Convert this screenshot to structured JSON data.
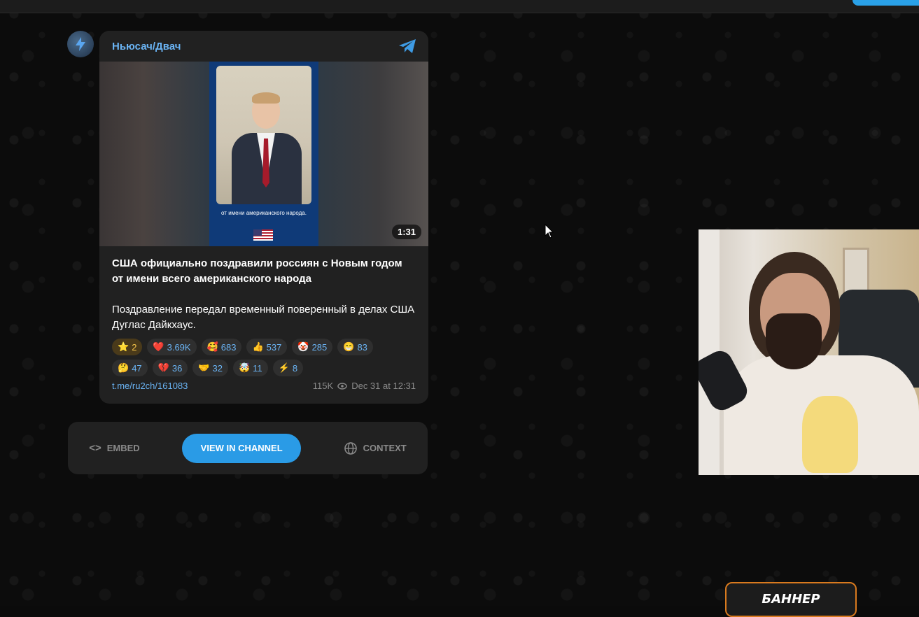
{
  "post": {
    "channel_name": "Ньюсач/Двач",
    "video": {
      "caption": "от имени американского народа.",
      "duration": "1:31"
    },
    "title": "США официально поздравили россиян с Новым годом от имени всего американского народа",
    "description": "Поздравление передал временный поверенный в делах США Дуглас Дайкхаус.",
    "reactions": [
      {
        "emoji": "⭐",
        "count": "2",
        "paid": true
      },
      {
        "emoji": "❤️",
        "count": "3.69K"
      },
      {
        "emoji": "🥰",
        "count": "683"
      },
      {
        "emoji": "👍",
        "count": "537"
      },
      {
        "emoji": "🤡",
        "count": "285"
      },
      {
        "emoji": "😁",
        "count": "83"
      },
      {
        "emoji": "🤔",
        "count": "47"
      },
      {
        "emoji": "💔",
        "count": "36"
      },
      {
        "emoji": "🤝",
        "count": "32"
      },
      {
        "emoji": "🤯",
        "count": "11"
      },
      {
        "emoji": "⚡",
        "count": "8"
      }
    ],
    "link": "t.me/ru2ch/161083",
    "views": "115K",
    "date": "Dec 31 at 12:31"
  },
  "actions": {
    "embed": "EMBED",
    "view_in_channel": "VIEW IN CHANNEL",
    "context": "CONTEXT"
  },
  "banner": {
    "text": "БАННЕР"
  },
  "colors": {
    "accent": "#2a9be6",
    "link": "#6ab3f3",
    "card": "#212121",
    "banner_border": "#d97a1e"
  }
}
